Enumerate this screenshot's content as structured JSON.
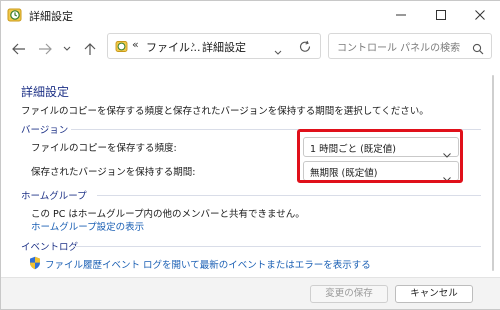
{
  "window": {
    "title": "詳細設定"
  },
  "nav": {
    "breadcrumb_prefix": "«",
    "breadcrumbs": [
      "ファイル...",
      "詳細設定"
    ],
    "breadcrumb_separator": "›",
    "search_placeholder": "コントロール パネルの検索"
  },
  "main": {
    "title": "詳細設定",
    "description": "ファイルのコピーを保存する頻度と保存されたバージョンを保持する期間を選択してください。",
    "versions": {
      "header": "バージョン",
      "frequency_label": "ファイルのコピーを保存する頻度:",
      "frequency_value": "1 時間ごと (既定値)",
      "retention_label": "保存されたバージョンを保持する期間:",
      "retention_value": "無期限 (既定値)"
    },
    "homegroup": {
      "header": "ホームグループ",
      "text": "この PC はホームグループ内の他のメンバーと共有できません。",
      "link": "ホームグループ設定の表示"
    },
    "eventlog": {
      "header": "イベントログ",
      "link": "ファイル履歴イベント ログを開いて最新のイベントまたはエラーを表示する"
    }
  },
  "footer": {
    "save_label": "変更の保存",
    "cancel_label": "キャンセル"
  },
  "colors": {
    "accent": "#1e3287",
    "link": "#1a5fb4",
    "highlight": "#e0101a"
  }
}
